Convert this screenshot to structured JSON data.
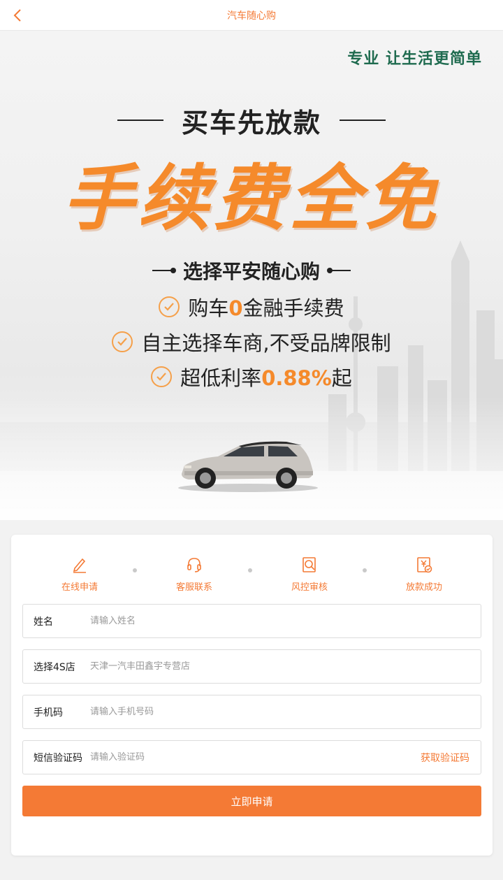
{
  "nav": {
    "title": "汽车随心购"
  },
  "hero": {
    "slogan": "专业 让生活更简单",
    "headline": "买车先放款",
    "big_title": "手续费全免",
    "subheadline": "选择平安随心购",
    "features": [
      {
        "before": "购车",
        "highlight": "0",
        "after": "金融手续费"
      },
      {
        "before": "自主选择车商,不受品牌限制",
        "highlight": "",
        "after": ""
      },
      {
        "before": "超低利率",
        "highlight": "0.88%",
        "after": "起"
      }
    ]
  },
  "steps": [
    {
      "label": "在线申请",
      "icon": "pencil-icon"
    },
    {
      "label": "客服联系",
      "icon": "headset-icon"
    },
    {
      "label": "风控审核",
      "icon": "audit-icon"
    },
    {
      "label": "放款成功",
      "icon": "loan-success-icon"
    }
  ],
  "form": {
    "name": {
      "label": "姓名",
      "placeholder": "请输入姓名"
    },
    "store": {
      "label": "选择4S店",
      "placeholder": "天津一汽丰田鑫宇专营店"
    },
    "phone": {
      "label": "手机码",
      "placeholder": "请输入手机号码"
    },
    "code": {
      "label": "短信验证码",
      "placeholder": "请输入验证码",
      "get_code": "获取验证码"
    },
    "submit": "立即申请"
  },
  "colors": {
    "accent": "#f47a35",
    "slogan_green": "#1f6b4f",
    "big_title_orange": "#f58a2b"
  }
}
